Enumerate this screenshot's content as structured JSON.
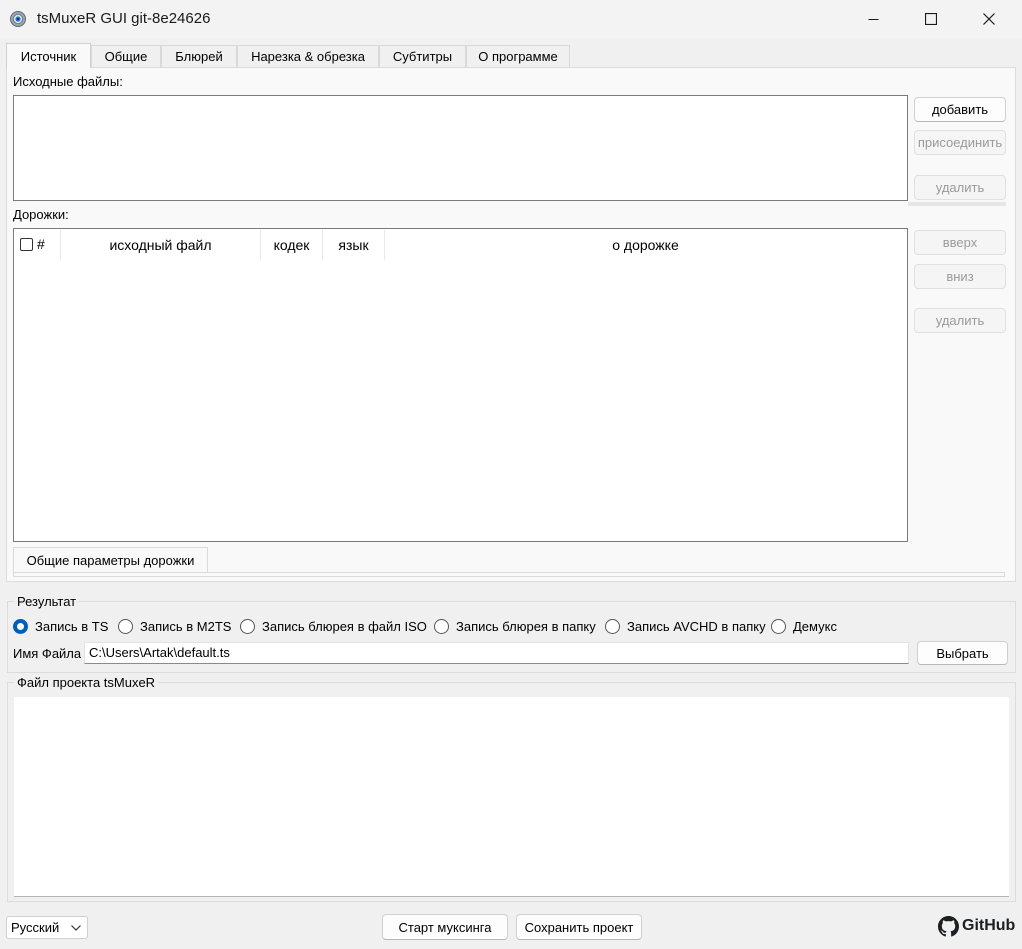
{
  "window": {
    "title": "tsMuxeR GUI git-8e24626",
    "icon": "gear-icon"
  },
  "tabs": [
    {
      "label": "Источник",
      "active": true
    },
    {
      "label": "Общие",
      "active": false
    },
    {
      "label": "Блюрей",
      "active": false
    },
    {
      "label": "Нарезка & обрезка",
      "active": false
    },
    {
      "label": "Субтитры",
      "active": false
    },
    {
      "label": "О программе",
      "active": false
    }
  ],
  "source": {
    "files_label": "Исходные файлы:",
    "add_label": "добавить",
    "join_label": "присоединить",
    "remove_label": "удалить"
  },
  "tracks": {
    "label": "Дорожки:",
    "columns": [
      "#",
      "исходный файл",
      "кодек",
      "язык",
      "о дорожке"
    ],
    "up_label": "вверх",
    "down_label": "вниз",
    "remove_label": "удалить",
    "subtab_label": "Общие параметры дорожки"
  },
  "result": {
    "title": "Результат",
    "options": [
      {
        "label": "Запись в TS",
        "selected": true
      },
      {
        "label": "Запись в M2TS",
        "selected": false
      },
      {
        "label": "Запись блюрея в файл ISO",
        "selected": false
      },
      {
        "label": "Запись блюрея в папку",
        "selected": false
      },
      {
        "label": "Запись AVCHD в папку",
        "selected": false
      },
      {
        "label": "Демукс",
        "selected": false
      }
    ],
    "filename_label": "Имя Файла",
    "filename_value": "C:\\Users\\Artak\\default.ts",
    "browse_label": "Выбрать"
  },
  "project": {
    "title": "Файл проекта tsMuxeR"
  },
  "footer": {
    "language_value": "Русский",
    "start_label": "Старт муксинга",
    "save_label": "Сохранить проект",
    "github_label": "GitHub"
  },
  "colors": {
    "accent": "#005fb8",
    "window_bg": "#f0f0f0"
  }
}
